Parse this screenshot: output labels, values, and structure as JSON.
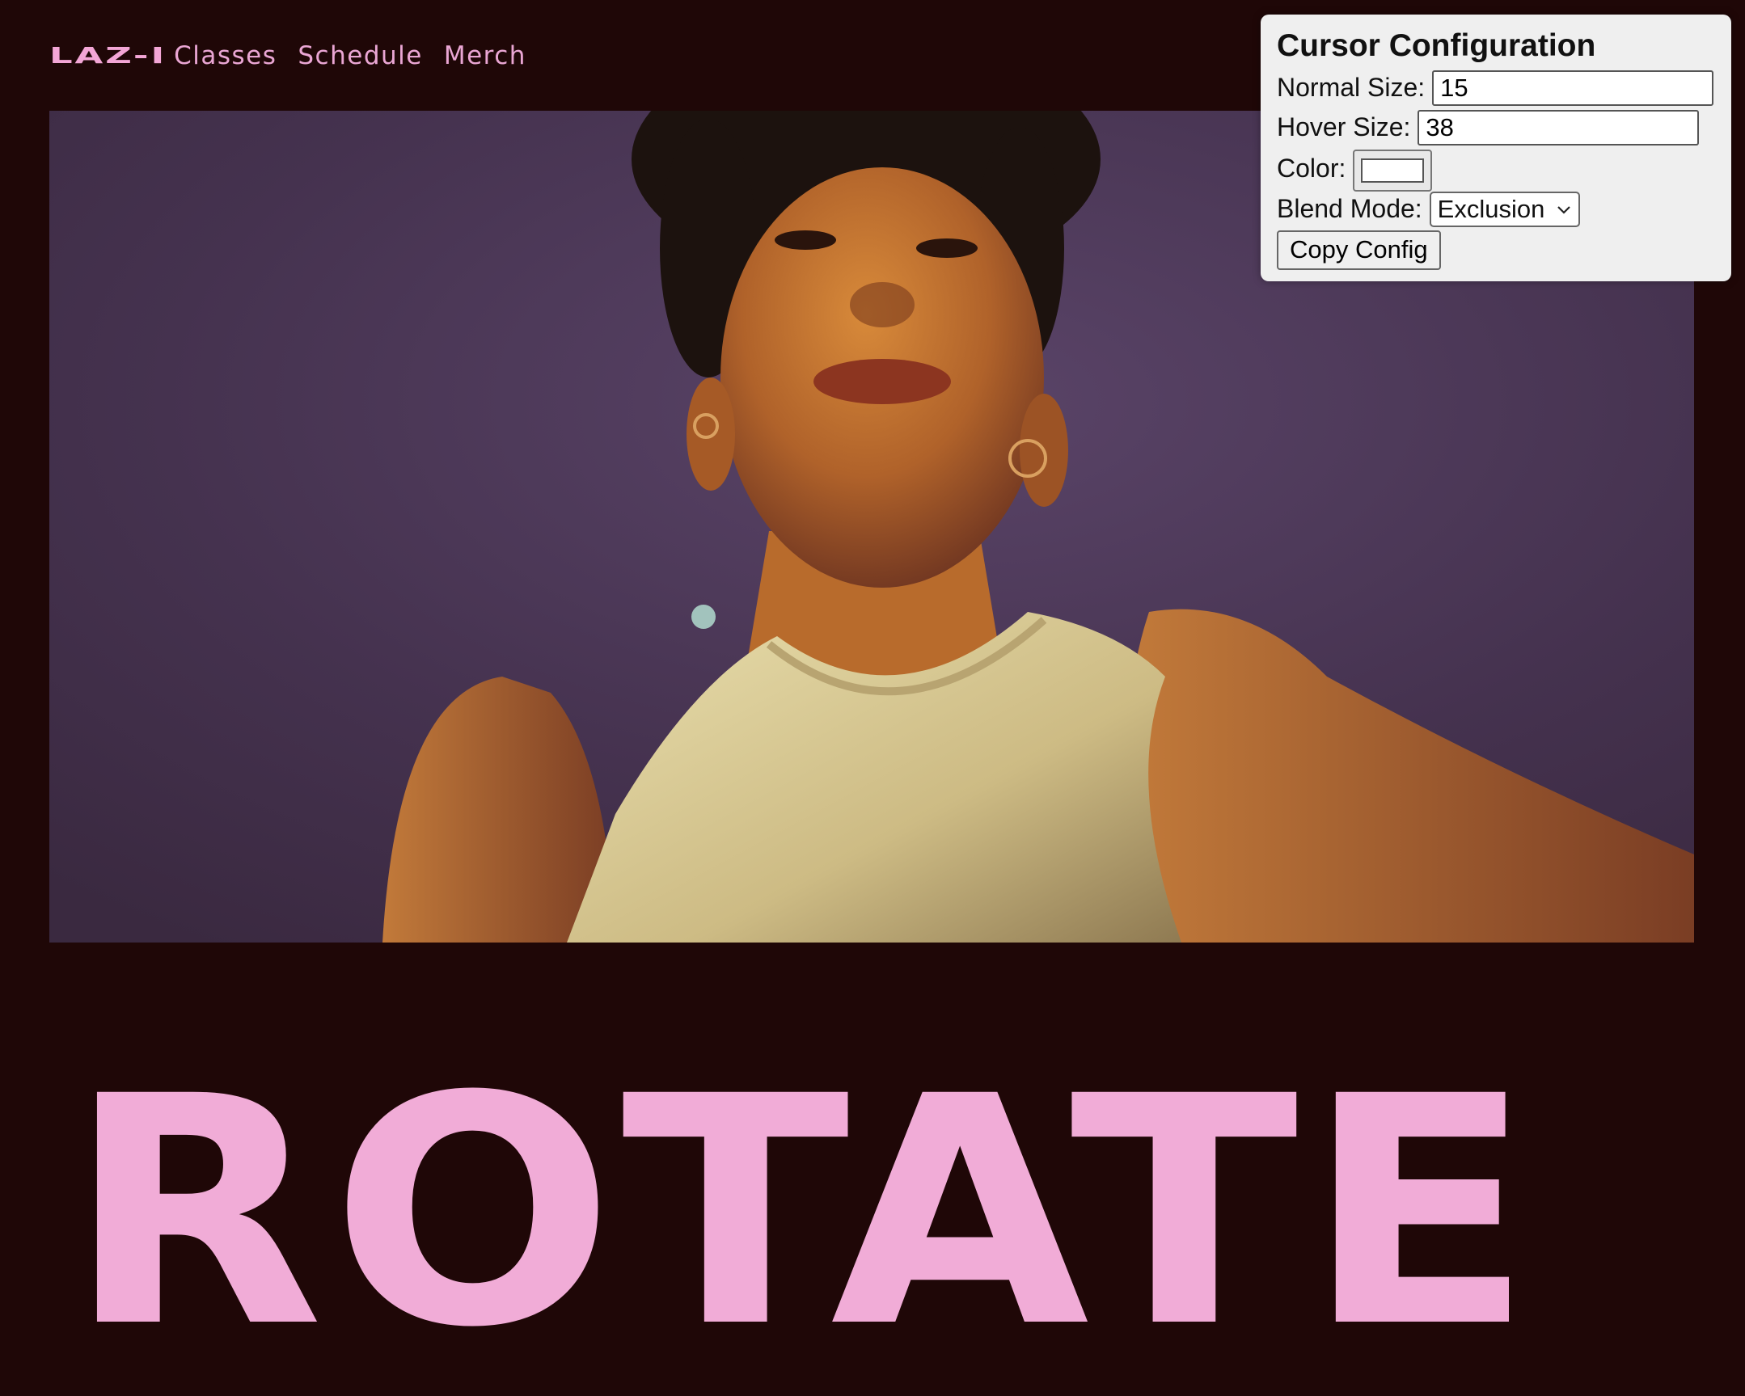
{
  "nav": {
    "logo": "LAZ-I",
    "links": [
      "Classes",
      "Schedule",
      "Merch"
    ]
  },
  "headline": "ROTATE",
  "cursor_panel": {
    "title": "Cursor Configuration",
    "normal_size_label": "Normal Size:",
    "normal_size_value": "15",
    "hover_size_label": "Hover Size:",
    "hover_size_value": "38",
    "color_label": "Color:",
    "color_value": "#ffffff",
    "blend_mode_label": "Blend Mode:",
    "blend_mode_value": "Exclusion",
    "copy_button_label": "Copy Config"
  },
  "colors": {
    "background": "#1f0707",
    "accent_pink": "#f1acd7",
    "cursor_dot": "#a9cfc6"
  },
  "icons": {
    "select_arrow": "chevron-down-icon"
  }
}
